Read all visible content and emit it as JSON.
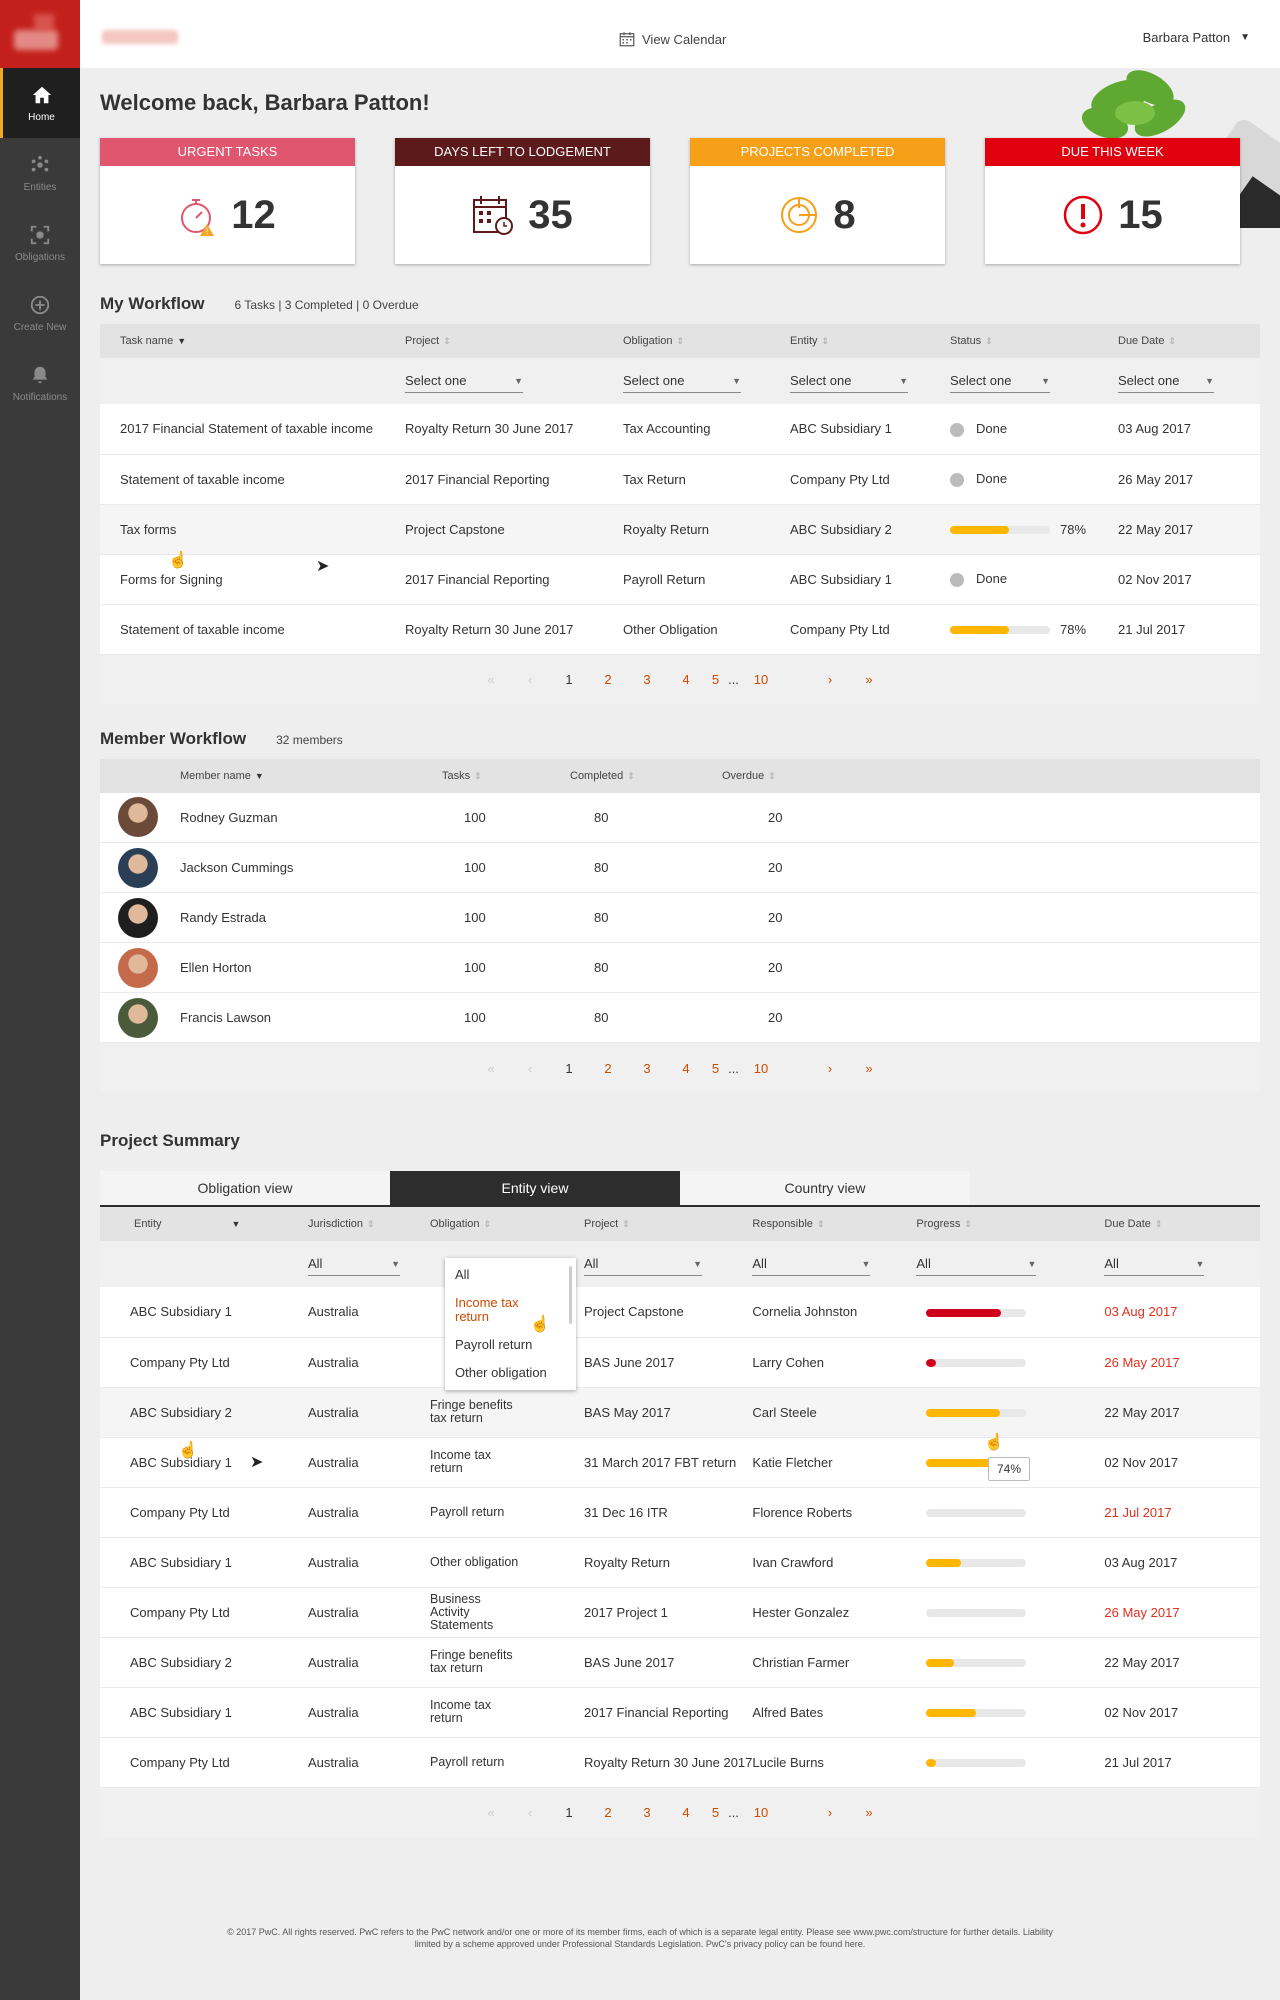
{
  "nav": [
    {
      "label": "Home",
      "icon": "home-icon"
    },
    {
      "label": "Entities",
      "icon": "entities-icon"
    },
    {
      "label": "Obligations",
      "icon": "obligations-icon"
    },
    {
      "label": "Create New",
      "icon": "plus-circle-icon"
    },
    {
      "label": "Notifications",
      "icon": "bell-icon"
    }
  ],
  "topbar": {
    "view_calendar": "View Calendar",
    "user_name": "Barbara Patton"
  },
  "welcome": "Welcome back, Barbara Patton!",
  "cards": [
    {
      "title": "URGENT TASKS",
      "value": "12",
      "color": "#e0566f",
      "icon": "stopwatch-alert-icon"
    },
    {
      "title": "DAYS LEFT TO LODGEMENT",
      "value": "35",
      "color": "#5c1a1a",
      "icon": "calendar-clock-icon"
    },
    {
      "title": "PROJECTS COMPLETED",
      "value": "8",
      "color": "#f5a018",
      "icon": "pie-chart-icon"
    },
    {
      "title": "DUE THIS WEEK",
      "value": "15",
      "color": "#e0020f",
      "icon": "alert-circle-icon"
    }
  ],
  "my_workflow": {
    "title": "My Workflow",
    "summary": "6 Tasks | 3 Completed | 0 Overdue",
    "columns": [
      "Task name",
      "Project",
      "Obligation",
      "Entity",
      "Status",
      "Due Date"
    ],
    "filter_placeholder": "Select one",
    "rows": [
      {
        "task": "2017 Financial Statement of taxable income",
        "project": "Royalty Return 30 June 2017",
        "obligation": "Tax Accounting",
        "entity": "ABC Subsidiary 1",
        "status": "Done",
        "progress": null,
        "due": "03 Aug 2017"
      },
      {
        "task": "Statement of taxable income",
        "project": "2017 Financial Reporting",
        "obligation": "Tax Return",
        "entity": "Company Pty Ltd",
        "status": "Done",
        "progress": null,
        "due": "26 May 2017"
      },
      {
        "task": "Tax forms",
        "project": "Project Capstone",
        "obligation": "Royalty Return",
        "entity": "ABC Subsidiary 2",
        "status": "78%",
        "progress": 78,
        "due": "22 May 2017"
      },
      {
        "task": "Forms for Signing",
        "project": "2017 Financial Reporting",
        "obligation": "Payroll Return",
        "entity": "ABC Subsidiary 1",
        "status": "Done",
        "progress": null,
        "due": "02 Nov 2017"
      },
      {
        "task": "Statement of taxable income",
        "project": "Royalty Return 30 June 2017",
        "obligation": "Other Obligation",
        "entity": "Company Pty Ltd",
        "status": "78%",
        "progress": 78,
        "due": "21 Jul 2017"
      }
    ]
  },
  "pager": {
    "pages": [
      "1",
      "2",
      "3",
      "4",
      "5",
      "...",
      "10"
    ],
    "current": "1",
    "first": "«",
    "prev": "‹",
    "next": "›",
    "last": "»"
  },
  "member_workflow": {
    "title": "Member Workflow",
    "summary": "32 members",
    "columns": [
      "Member name",
      "Tasks",
      "Completed",
      "Overdue"
    ],
    "rows": [
      {
        "name": "Rodney Guzman",
        "tasks": "100",
        "completed": "80",
        "overdue": "20",
        "avatar_color": "#6b4a3a"
      },
      {
        "name": "Jackson Cummings",
        "tasks": "100",
        "completed": "80",
        "overdue": "20",
        "avatar_color": "#2a3f55"
      },
      {
        "name": "Randy Estrada",
        "tasks": "100",
        "completed": "80",
        "overdue": "20",
        "avatar_color": "#1e1e1e"
      },
      {
        "name": "Ellen Horton",
        "tasks": "100",
        "completed": "80",
        "overdue": "20",
        "avatar_color": "#c46a4a"
      },
      {
        "name": "Francis Lawson",
        "tasks": "100",
        "completed": "80",
        "overdue": "20",
        "avatar_color": "#4a5a3a"
      }
    ]
  },
  "project_summary": {
    "title": "Project Summary",
    "tabs": [
      "Obligation view",
      "Entity view",
      "Country view"
    ],
    "active_tab": "Entity view",
    "columns": [
      "Entity",
      "Jurisdiction",
      "Obligation",
      "Project",
      "Responsible",
      "Progress",
      "Due Date"
    ],
    "filter_all": "All",
    "obligation_dropdown": [
      "All",
      "Income tax return",
      "Payroll return",
      "Other obligation"
    ],
    "rows": [
      {
        "entity": "ABC Subsidiary 1",
        "jurisdiction": "Australia",
        "obligation": "",
        "project": "Project Capstone",
        "responsible": "Cornelia Johnston",
        "progress": 75,
        "bar_color": "#d0021b",
        "due": "03 Aug 2017",
        "overdue": true
      },
      {
        "entity": "Company Pty Ltd",
        "jurisdiction": "Australia",
        "obligation": "",
        "project": "BAS June 2017",
        "responsible": "Larry Cohen",
        "progress": 8,
        "bar_color": "#d0021b",
        "due": "26 May 2017",
        "overdue": true
      },
      {
        "entity": "ABC Subsidiary 2",
        "jurisdiction": "Australia",
        "obligation": "Fringe benefits tax return",
        "project": "BAS May 2017",
        "responsible": "Carl Steele",
        "progress": 74,
        "bar_color": "#ffb600",
        "due": "22 May 2017",
        "overdue": false
      },
      {
        "entity": "ABC Subsidiary 1",
        "jurisdiction": "Australia",
        "obligation": "Income tax return",
        "project": "31 March 2017 FBT return",
        "responsible": "Katie Fletcher",
        "progress": 74,
        "bar_color": "#ffb600",
        "due": "02 Nov 2017",
        "overdue": false
      },
      {
        "entity": "Company Pty Ltd",
        "jurisdiction": "Australia",
        "obligation": "Payroll return",
        "project": "31 Dec 16 ITR",
        "responsible": "Florence Roberts",
        "progress": 0,
        "bar_color": "#ffb600",
        "due": "21 Jul 2017",
        "overdue": true
      },
      {
        "entity": "ABC Subsidiary 1",
        "jurisdiction": "Australia",
        "obligation": "Other obligation",
        "project": "Royalty Return",
        "responsible": "Ivan Crawford",
        "progress": 35,
        "bar_color": "#ffb600",
        "due": "03 Aug 2017",
        "overdue": false
      },
      {
        "entity": "Company Pty Ltd",
        "jurisdiction": "Australia",
        "obligation": "Business Activity Statements",
        "project": "2017 Project 1",
        "responsible": "Hester Gonzalez",
        "progress": 0,
        "bar_color": "#ffb600",
        "due": "26 May 2017",
        "overdue": true
      },
      {
        "entity": "ABC Subsidiary 2",
        "jurisdiction": "Australia",
        "obligation": "Fringe benefits tax return",
        "project": "BAS June 2017",
        "responsible": "Christian Farmer",
        "progress": 28,
        "bar_color": "#ffb600",
        "due": "22 May 2017",
        "overdue": false
      },
      {
        "entity": "ABC Subsidiary 1",
        "jurisdiction": "Australia",
        "obligation": "Income tax return",
        "project": "2017 Financial Reporting",
        "responsible": "Alfred Bates",
        "progress": 50,
        "bar_color": "#ffb600",
        "due": "02 Nov 2017",
        "overdue": false
      },
      {
        "entity": "Company Pty Ltd",
        "jurisdiction": "Australia",
        "obligation": "Payroll return",
        "project": "Royalty Return 30 June 2017",
        "responsible": "Lucile Burns",
        "progress": 8,
        "bar_color": "#ffb600",
        "due": "21 Jul 2017",
        "overdue": false
      }
    ],
    "tooltip": "74%"
  },
  "footer": "© 2017 PwC. All rights reserved. PwC refers to the PwC network and/or one or more of its member firms, each of which is a separate legal entity. Please see www.pwc.com/structure for further details. Liability limited by a scheme approved under Professional Standards Legislation. PwC's privacy policy can be found here."
}
